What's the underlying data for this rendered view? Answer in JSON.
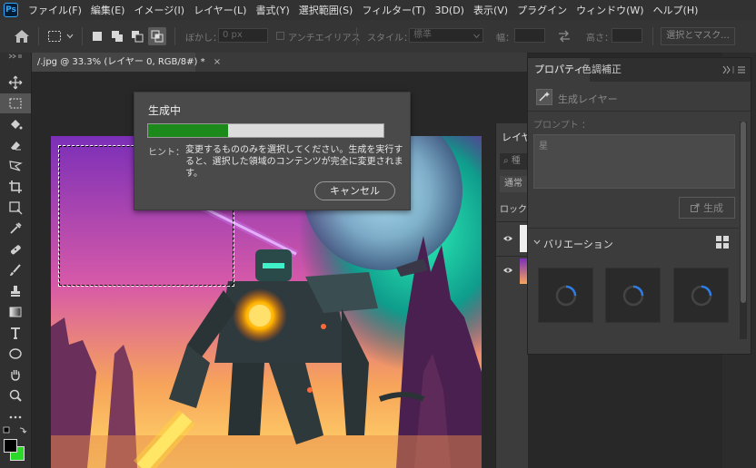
{
  "app": {
    "logo_text": "Ps"
  },
  "menubar": {
    "items": [
      "ファイル(F)",
      "編集(E)",
      "イメージ(I)",
      "レイヤー(L)",
      "書式(Y)",
      "選択範囲(S)",
      "フィルター(T)",
      "3D(D)",
      "表示(V)",
      "プラグイン",
      "ウィンドウ(W)",
      "ヘルプ(H)"
    ]
  },
  "options_bar": {
    "feather_label": "ぼかし：",
    "feather_value": "0 px",
    "antialias_label": "アンチエイリアス",
    "style_label": "スタイル：",
    "style_value": "標準",
    "width_label": "幅：",
    "height_label": "高さ：",
    "select_mask_label": "選択とマスク..."
  },
  "document": {
    "tab_title": "/.jpg @ 33.3% (レイヤー 0, RGB/8#) *",
    "close_glyph": "×"
  },
  "dialog": {
    "title": "生成中",
    "progress": 0.34,
    "hint_label": "ヒント：",
    "hint_text": "変更するもののみを選択してください。生成を実行すると、選択した領域のコンテンツが完全に変更されます。",
    "cancel_label": "キャンセル"
  },
  "layers_panel": {
    "title": "レイヤー",
    "search_placeholder": "種",
    "blend_mode": "通常",
    "lock_label": "ロック："
  },
  "properties_panel": {
    "tabs": [
      "プロパティ",
      "色調補正"
    ],
    "layer_type": "生成レイヤー",
    "prompt_label": "プロンプト ：",
    "prompt_placeholder": "星",
    "generate_label": "生成",
    "variations_label": "バリエーション"
  },
  "colors": {
    "accent_green": "#1b8a1b",
    "foreground_swatch": "#000000",
    "background_swatch": "#2ad92a",
    "spinner_blue": "#2e7ce6"
  }
}
